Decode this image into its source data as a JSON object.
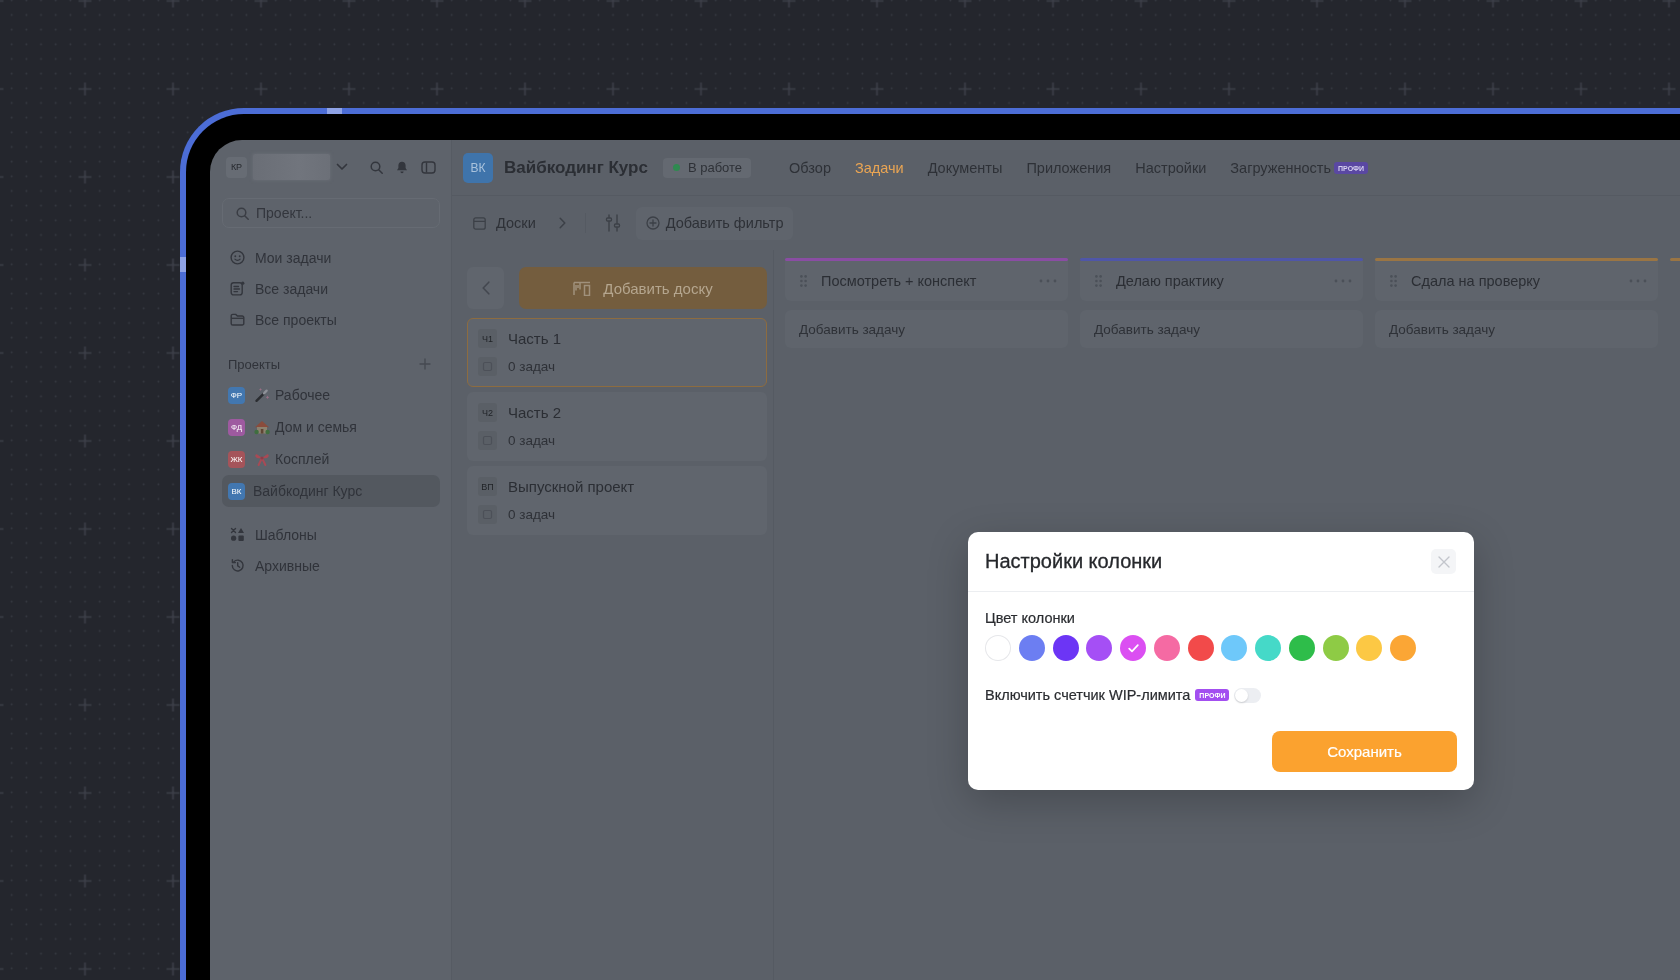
{
  "sidebar": {
    "account": {
      "initials": "КР"
    },
    "search": {
      "placeholder": "Проект..."
    },
    "nav": [
      {
        "label": "Мои задачи"
      },
      {
        "label": "Все задачи"
      },
      {
        "label": "Все проекты"
      }
    ],
    "projects_heading": "Проекты",
    "projects": [
      {
        "initials": "ФР",
        "label": "Рабочее",
        "color": "#4277b0",
        "selected": false
      },
      {
        "initials": "ФД",
        "label": "Дом и семья",
        "color": "#9e5aa0",
        "selected": false
      },
      {
        "initials": "ЖК",
        "label": "Косплей",
        "color": "#a5545a",
        "selected": false
      },
      {
        "initials": "ВК",
        "label": "Вайбкодинг Курс",
        "color": "#4277b0",
        "selected": true
      }
    ],
    "footer_nav": [
      {
        "label": "Шаблоны"
      },
      {
        "label": "Архивные"
      }
    ]
  },
  "header": {
    "initials": "ВК",
    "title": "Вайбкодинг Курс",
    "status": "В работе",
    "tabs": [
      {
        "label": "Обзор",
        "selected": false
      },
      {
        "label": "Задачи",
        "selected": true
      },
      {
        "label": "Документы",
        "selected": false
      },
      {
        "label": "Приложения",
        "selected": false
      },
      {
        "label": "Настройки",
        "selected": false
      },
      {
        "label": "Загруженность",
        "selected": false,
        "badge": "ПРОФИ"
      }
    ]
  },
  "toolbar": {
    "boards_label": "Доски",
    "filter_label": "Добавить фильтр"
  },
  "boards": {
    "add_label": "Добавить доску",
    "items": [
      {
        "code": "Ч1",
        "name": "Часть 1",
        "count": "0 задач",
        "selected": true
      },
      {
        "code": "Ч2",
        "name": "Часть 2",
        "count": "0 задач",
        "selected": false
      },
      {
        "code": "ВП",
        "name": "Выпускной проект",
        "count": "0 задач",
        "selected": false
      }
    ]
  },
  "columns": [
    {
      "title": "Посмотреть + конспект",
      "color": "#8a4da3",
      "add_label": "Добавить задачу"
    },
    {
      "title": "Делаю практику",
      "color": "#4f56a8",
      "add_label": "Добавить задачу"
    },
    {
      "title": "Сдала на проверку",
      "color": "#9a7544",
      "add_label": "Добавить задачу"
    },
    {
      "color": "#9a7544"
    }
  ],
  "modal": {
    "title": "Настройки колонки",
    "color_label": "Цвет колонки",
    "swatches": [
      {
        "color": "#ffffff",
        "selected": false
      },
      {
        "color": "#6c7ef2",
        "selected": false
      },
      {
        "color": "#6c35f5",
        "selected": false
      },
      {
        "color": "#a54ff5",
        "selected": false
      },
      {
        "color": "#db4ff2",
        "selected": true
      },
      {
        "color": "#f56aa3",
        "selected": false
      },
      {
        "color": "#f24a4a",
        "selected": false
      },
      {
        "color": "#6ec8fa",
        "selected": false
      },
      {
        "color": "#45d9c8",
        "selected": false
      },
      {
        "color": "#2ebd4a",
        "selected": false
      },
      {
        "color": "#8ecb45",
        "selected": false
      },
      {
        "color": "#fcc844",
        "selected": false
      },
      {
        "color": "#fba635",
        "selected": false
      }
    ],
    "wip": {
      "label": "Включить счетчик WIP-лимита",
      "badge": "ПРОФИ",
      "on": false
    },
    "save_label": "Сохранить"
  }
}
